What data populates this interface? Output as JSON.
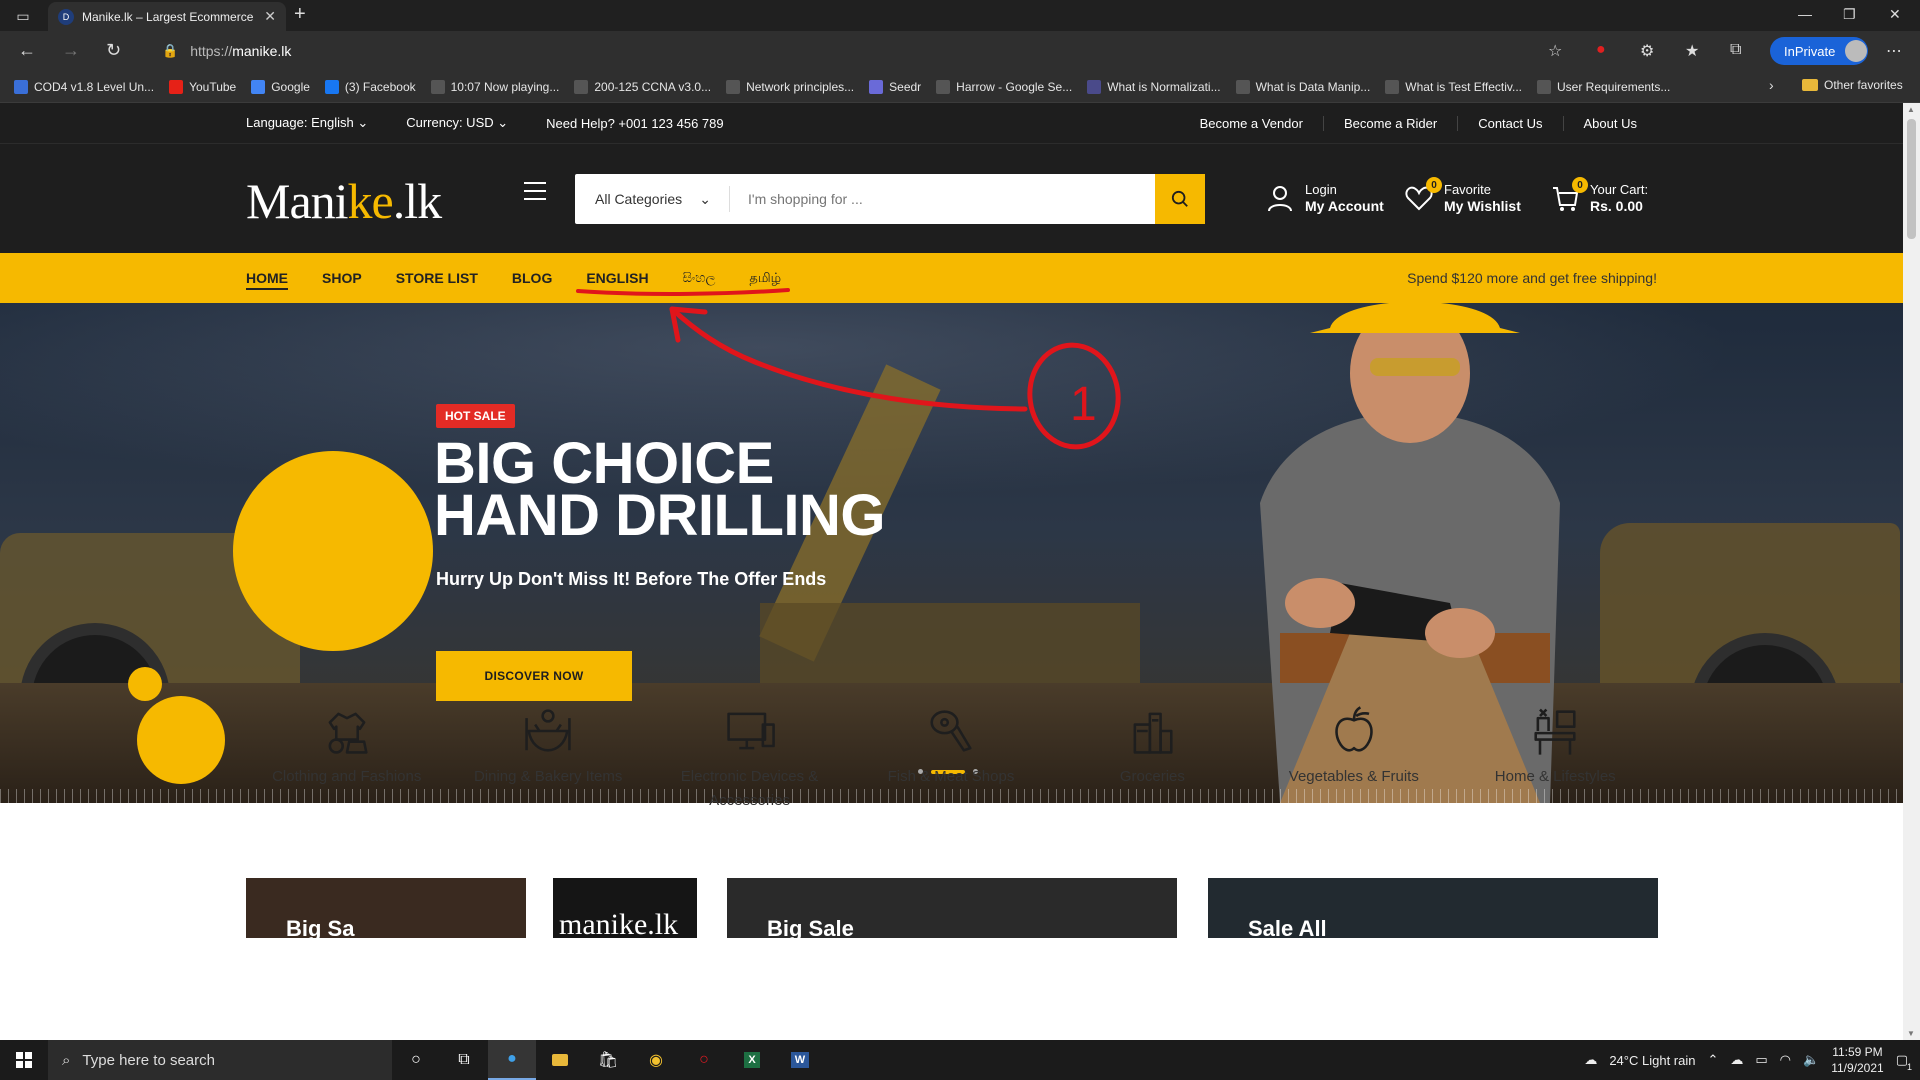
{
  "browser": {
    "tab_title": "Manike.lk – Largest Ecommerce",
    "url_scheme": "https://",
    "url_host": "manike.lk",
    "inprivate_label": "InPrivate",
    "bookmarks": [
      {
        "label": "COD4 v1.8 Level Un...",
        "color": "#3a6fd8"
      },
      {
        "label": "YouTube",
        "color": "#e62117"
      },
      {
        "label": "Google",
        "color": "#4285f4"
      },
      {
        "label": "(3) Facebook",
        "color": "#1877f2"
      },
      {
        "label": "10:07 Now playing...",
        "color": "#555555"
      },
      {
        "label": "200-125 CCNA v3.0...",
        "color": "#555555"
      },
      {
        "label": "Network principles...",
        "color": "#555555"
      },
      {
        "label": "Seedr",
        "color": "#6a6ad8"
      },
      {
        "label": "Harrow - Google Se...",
        "color": "#555555"
      },
      {
        "label": "What is Normalizati...",
        "color": "#4a4a8a"
      },
      {
        "label": "What is Data Manip...",
        "color": "#555555"
      },
      {
        "label": "What is Test Effectiv...",
        "color": "#555555"
      },
      {
        "label": "User Requirements...",
        "color": "#555555"
      }
    ],
    "other_favorites": "Other favorites"
  },
  "topbar": {
    "language": "Language: English",
    "currency": "Currency: USD",
    "help": "Need Help? +001 123 456 789",
    "links": [
      "Become a Vendor",
      "Become a Rider",
      "Contact Us",
      "About Us"
    ]
  },
  "header": {
    "logo_main": "Mani",
    "logo_accent": "ke",
    "logo_tail": ".lk",
    "search_category": "All Categories",
    "search_placeholder": "I'm shopping for ...",
    "login_label": "Login",
    "account_label": "My Account",
    "favorite_label": "Favorite",
    "wishlist_label": "My Wishlist",
    "wishlist_count": "0",
    "cart_label": "Your Cart:",
    "cart_total": "Rs. 0.00",
    "cart_count": "0"
  },
  "menu": {
    "items": [
      "HOME",
      "SHOP",
      "STORE LIST",
      "BLOG",
      "ENGLISH",
      "සිංහල",
      "தமிழ்"
    ],
    "promo": "Spend $120 more and get free shipping!"
  },
  "hero": {
    "badge": "HOT SALE",
    "title_line1": "BIG CHOICE",
    "title_line2": "HAND DRILLING",
    "subtitle": "Hurry Up Don't Miss It! Before The Offer Ends",
    "cta": "DISCOVER NOW"
  },
  "categories": [
    {
      "label": "Clothing and Fashions"
    },
    {
      "label": "Dining & Bakery Items"
    },
    {
      "label": "Electronic Devices & Accessories"
    },
    {
      "label": "Fish & Meat Shops"
    },
    {
      "label": "Groceries"
    },
    {
      "label": "Vegetables & Fruits"
    },
    {
      "label": "Home & Lifestyles"
    }
  ],
  "banners": [
    "Big Sa",
    "manike.lk",
    "Big Sale",
    "Sale All"
  ],
  "annotation": {
    "label": "1",
    "color": "#e0151b"
  },
  "taskbar": {
    "search_placeholder": "Type here to search",
    "weather": "24°C  Light rain",
    "time": "11:59 PM",
    "date": "11/9/2021",
    "notif_count": "1"
  },
  "colors": {
    "brand_yellow": "#f6b900",
    "dark": "#1e1e1e",
    "hot_red": "#e32b25"
  }
}
